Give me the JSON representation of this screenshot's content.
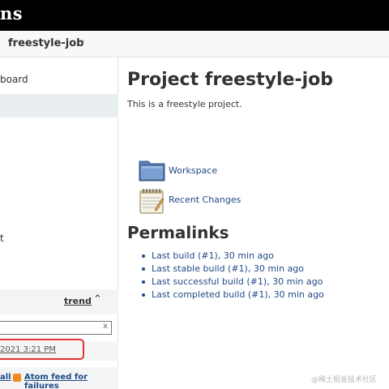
{
  "header": {
    "brand": "ns"
  },
  "breadcrumb": {
    "job": "freestyle-job",
    "chevron": "›"
  },
  "sidebar": {
    "dashboard_label": "board",
    "partial_item": "t"
  },
  "build_history": {
    "trend_label": "trend",
    "collapse_symbol": "⌃",
    "filter_clear": "x",
    "build_link": "2021 3:21 PM",
    "feed_all": "all",
    "feed_failures": "Atom feed for failures"
  },
  "main": {
    "title": "Project freestyle-job",
    "description": "This is a freestyle project.",
    "links": [
      {
        "label": "Workspace",
        "icon": "folder-icon"
      },
      {
        "label": "Recent Changes",
        "icon": "notepad-icon"
      }
    ],
    "permalinks_title": "Permalinks",
    "permalinks": [
      "Last build (#1), 30 min ago",
      "Last stable build (#1), 30 min ago",
      "Last successful build (#1), 30 min ago",
      "Last completed build (#1), 30 min ago"
    ]
  },
  "watermark": "@稀土掘金技术社区",
  "colors": {
    "link": "#204a87",
    "highlight": "#e23434",
    "header": "#000000"
  }
}
